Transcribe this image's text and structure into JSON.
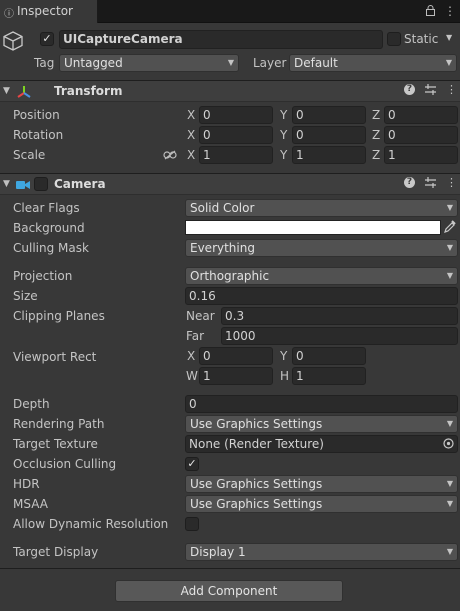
{
  "tab": {
    "title": "Inspector"
  },
  "object": {
    "name": "UICaptureCamera",
    "active": true,
    "static_label": "Static",
    "static": false,
    "tag_label": "Tag",
    "tag_value": "Untagged",
    "layer_label": "Layer",
    "layer_value": "Default"
  },
  "transform": {
    "title": "Transform",
    "position_label": "Position",
    "rotation_label": "Rotation",
    "scale_label": "Scale",
    "axis_x": "X",
    "axis_y": "Y",
    "axis_z": "Z",
    "position": {
      "x": "0",
      "y": "0",
      "z": "0"
    },
    "rotation": {
      "x": "0",
      "y": "0",
      "z": "0"
    },
    "scale": {
      "x": "1",
      "y": "1",
      "z": "1"
    }
  },
  "camera": {
    "title": "Camera",
    "enabled": false,
    "clear_flags_label": "Clear Flags",
    "clear_flags_value": "Solid Color",
    "background_label": "Background",
    "background_color": "#ffffff",
    "culling_mask_label": "Culling Mask",
    "culling_mask_value": "Everything",
    "projection_label": "Projection",
    "projection_value": "Orthographic",
    "size_label": "Size",
    "size_value": "0.16",
    "clipping_label": "Clipping Planes",
    "near_label": "Near",
    "near_value": "0.3",
    "far_label": "Far",
    "far_value": "1000",
    "viewport_label": "Viewport Rect",
    "vp_x_label": "X",
    "vp_x": "0",
    "vp_y_label": "Y",
    "vp_y": "0",
    "vp_w_label": "W",
    "vp_w": "1",
    "vp_h_label": "H",
    "vp_h": "1",
    "depth_label": "Depth",
    "depth_value": "0",
    "rendering_path_label": "Rendering Path",
    "rendering_path_value": "Use Graphics Settings",
    "target_texture_label": "Target Texture",
    "target_texture_value": "None (Render Texture)",
    "occlusion_label": "Occlusion Culling",
    "occlusion": true,
    "hdr_label": "HDR",
    "hdr_value": "Use Graphics Settings",
    "msaa_label": "MSAA",
    "msaa_value": "Use Graphics Settings",
    "dyn_res_label": "Allow Dynamic Resolution",
    "dyn_res": false,
    "target_display_label": "Target Display",
    "target_display_value": "Display 1"
  },
  "add_component_label": "Add Component",
  "icons": {
    "check": "✓",
    "dropdown_arrow": "▼",
    "foldout": "▼",
    "help": "?",
    "kebab": "⋮"
  }
}
